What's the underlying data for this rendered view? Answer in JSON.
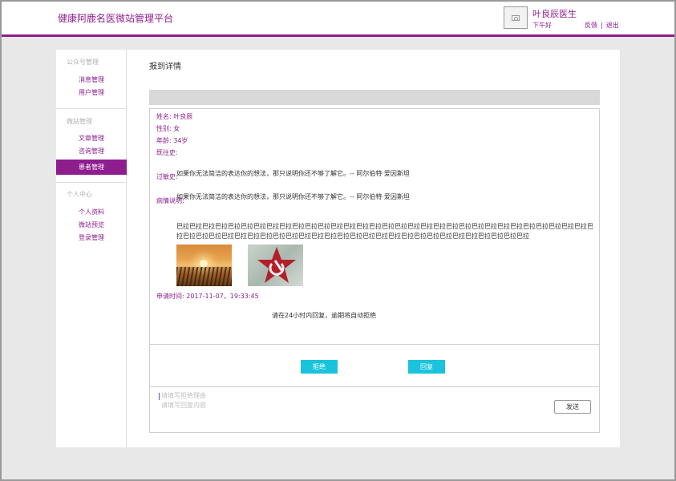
{
  "header": {
    "brand": "健康阿鹿名医微站管理平台",
    "doctor_name": "叶良辰医生",
    "greeting": "下午好",
    "feedback": "反馈",
    "separator": "|",
    "logout": "退出",
    "accent_color": "#8e1d8e"
  },
  "sidebar": {
    "groups": [
      {
        "title": "公众号管理",
        "items": [
          {
            "label": "消息管理"
          },
          {
            "label": "用户管理"
          }
        ]
      },
      {
        "title": "微站管理",
        "items": [
          {
            "label": "文章管理"
          },
          {
            "label": "咨询管理"
          },
          {
            "label": "患者管理",
            "active": true
          }
        ]
      },
      {
        "title": "个人中心",
        "items": [
          {
            "label": "个人资料"
          },
          {
            "label": "微站预览"
          },
          {
            "label": "登录管理"
          }
        ]
      }
    ]
  },
  "main": {
    "title": "报到详情",
    "patient": {
      "name_label": "姓名:",
      "name": "叶良辰",
      "gender_label": "性别:",
      "gender": "女",
      "age_label": "年龄:",
      "age": "34岁",
      "history_label": "既往史:",
      "allergy_label": "过敏史:",
      "allergy_text": "如果你无法简洁的表达你的想法，那只说明你还不够了解它。-- 阿尔伯特·爱因斯坦",
      "condition_label": "病情说明:",
      "condition_text": "如果你无法简洁的表达你的想法，那只说明你还不够了解它。-- 阿尔伯特·爱因斯坦",
      "long_text": "巴拉巴拉巴拉巴拉巴拉巴拉巴拉巴拉巴拉巴拉巴拉巴拉巴拉巴拉巴拉巴拉巴拉巴拉巴拉巴拉巴拉巴拉巴拉巴拉巴拉巴拉巴拉巴拉巴拉巴拉巴拉巴拉巴拉巴拉巴拉巴拉巴拉巴拉巴拉巴拉巴拉巴拉巴拉巴拉巴拉巴拉巴拉巴拉巴拉巴拉巴拉巴拉巴拉巴拉巴拉巴拉巴拉巴拉巴拉巴拉"
    },
    "apply_time_label": "申请时间:",
    "apply_time": "2017-11-07，19:33:45",
    "notice": "请在24小时内回复，逾期将自动拒绝",
    "reject_button": "拒绝",
    "reply_button": "回复",
    "reject_placeholder": "请填写拒绝理由",
    "reply_placeholder": "请填写回复内容",
    "send_button": "发送",
    "button_color": "#19c3dc"
  }
}
